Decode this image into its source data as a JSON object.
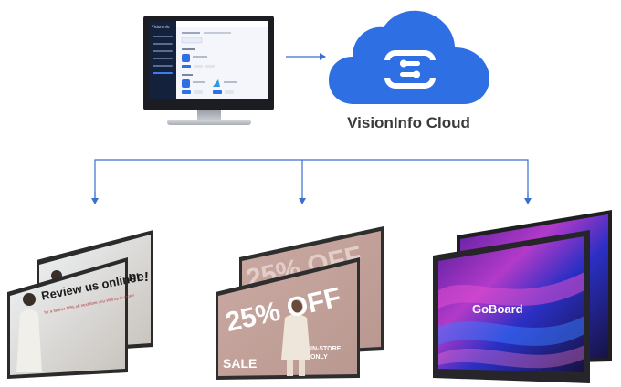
{
  "cloud": {
    "title": "VisionInfo Cloud",
    "color": "#2f6fe4"
  },
  "connector_color": "#3a6fd0",
  "displays": {
    "left": {
      "headline": "Review us online!",
      "subtext": "for a further 10% off next time you visit us in-store!"
    },
    "middle": {
      "headline": "25% OFF",
      "sale": "SALE",
      "instore": "IN-STORE ONLY"
    },
    "right": {
      "brand": "GoBoard"
    }
  }
}
